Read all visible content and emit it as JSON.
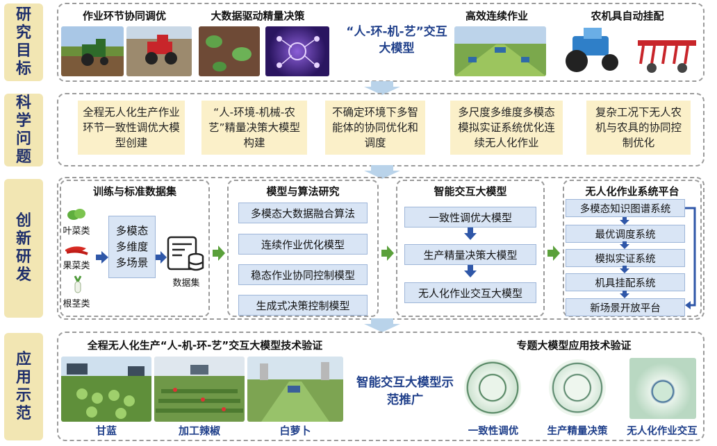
{
  "sections": {
    "goal": [
      "研",
      "究",
      "目",
      "标"
    ],
    "problem": [
      "科",
      "学",
      "问",
      "题"
    ],
    "innovation": [
      "创",
      "新",
      "研",
      "发"
    ],
    "demo": [
      "应",
      "用",
      "示",
      "范"
    ]
  },
  "goal": {
    "titles": [
      "作业环节协同调优",
      "大数据驱动精量决策",
      "高效连续作业",
      "农机具自动挂配"
    ],
    "center": "“人-环-机-艺”交互大模型"
  },
  "problems": [
    "全程无人化生产作业环节一致性调优大模型创建",
    "“人-环境-机械-农艺”精量决策大模型构建",
    "不确定环境下多智能体的协同优化和调度",
    "多尺度多维度多模态模拟实证系统优化连续无人化作业",
    "复杂工况下无人农机与农具的协同控制优化"
  ],
  "innovation": {
    "dataset": {
      "title": "训练与标准数据集",
      "crops": [
        "叶菜类",
        "果菜类",
        "根茎类"
      ],
      "dims": [
        "多模态",
        "多维度",
        "多场景"
      ],
      "db_label": "数据集"
    },
    "models": {
      "title": "模型与算法研究",
      "items": [
        "多模态大数据融合算法",
        "连续作业优化模型",
        "稳态作业协同控制模型",
        "生成式决策控制模型"
      ]
    },
    "interactive": {
      "title": "智能交互大模型",
      "items": [
        "一致性调优大模型",
        "生产精量决策大模型",
        "无人化作业交互大模型"
      ]
    },
    "platform": {
      "title": "无人化作业系统平台",
      "items": [
        "多模态知识图谱系统",
        "最优调度系统",
        "模拟实证系统",
        "机具挂配系统",
        "新场景开放平台"
      ]
    }
  },
  "demo": {
    "left_title": "全程无人化生产“人-机-环-艺”交互大模型技术验证",
    "left_labels": [
      "甘蓝",
      "加工辣椒",
      "白萝卜"
    ],
    "center": "智能交互大模型示范推广",
    "right_title": "专题大模型应用技术验证",
    "right_labels": [
      "一致性调优",
      "生产精量决策",
      "无人化作业交互"
    ]
  },
  "colors": {
    "side_bg": "#f2e6b3",
    "side_text": "#1f2f6b",
    "problem_bg": "#fbf0c9",
    "box_bg": "#d9e5f5",
    "blue_arrow": "#2f57a8",
    "green_arrow": "#5aa03a",
    "down_arrow": "#b9d3ea",
    "label_blue": "#1f3f8a"
  }
}
